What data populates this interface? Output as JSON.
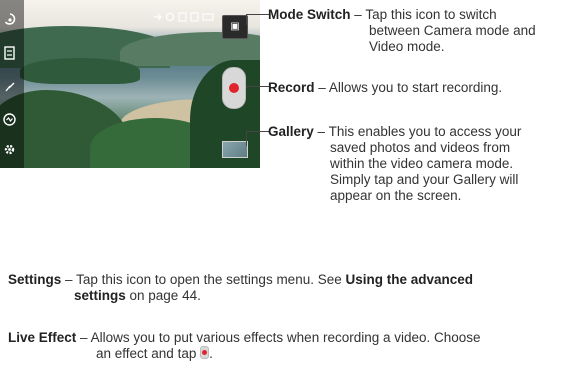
{
  "callouts": {
    "mode_switch": {
      "term": "Mode Switch",
      "line1": "Tap this icon to switch",
      "line2": "between Camera mode and",
      "line3": "Video mode."
    },
    "record": {
      "term": "Record",
      "text": "Allows you to start recording."
    },
    "gallery": {
      "term": "Gallery",
      "line1": "This enables you to access your",
      "line2": "saved photos and videos from",
      "line3": "within the video camera mode.",
      "line4": "Simply tap and your Gallery will",
      "line5": "appear on the screen."
    }
  },
  "settings": {
    "term": "Settings",
    "line1_pre": "Tap this icon to open the settings menu. See ",
    "line1_bold": "Using the advanced",
    "line2_bold": "settings",
    "line2_post": " on page 44."
  },
  "live_effect": {
    "term": "Live Effect",
    "line1": "Allows you to put various effects when recording a video. Choose",
    "line2_pre": "an effect and tap ",
    "line2_post": "."
  },
  "dash": "–",
  "viewfinder": {
    "mode_switch_glyph": "▣",
    "icons": [
      "gear-icon",
      "live-effect-icon",
      "flash-icon",
      "scene-icon",
      "switch-camera-icon"
    ]
  }
}
